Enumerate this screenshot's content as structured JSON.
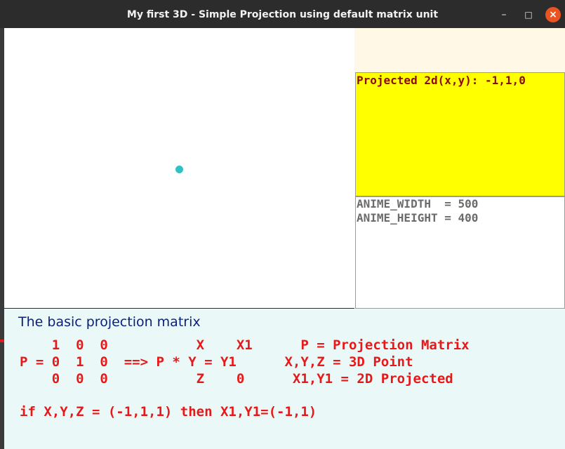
{
  "window": {
    "title": "My first 3D - Simple Projection using default matrix unit",
    "minimize_glyph": "–",
    "maximize_glyph": "□",
    "close_glyph": "×"
  },
  "canvas": {
    "point_color": "#2dc2c4"
  },
  "right_panel": {
    "projected_text": "Projected 2d(x,y): -1,1,0",
    "anime_width_line": "ANIME_WIDTH  = 500",
    "anime_height_line": "ANIME_HEIGHT = 400"
  },
  "explanation": {
    "heading": "The basic projection matrix",
    "line1": "    1  0  0           X    X1      P = Projection Matrix",
    "line2": "P = 0  1  0  ==> P * Y = Y1      X,Y,Z = 3D Point",
    "line3": "    0  0  0           Z    0      X1,Y1 = 2D Projected",
    "line4": "if X,Y,Z = (-1,1,1) then X1,Y1=(-1,1)"
  }
}
